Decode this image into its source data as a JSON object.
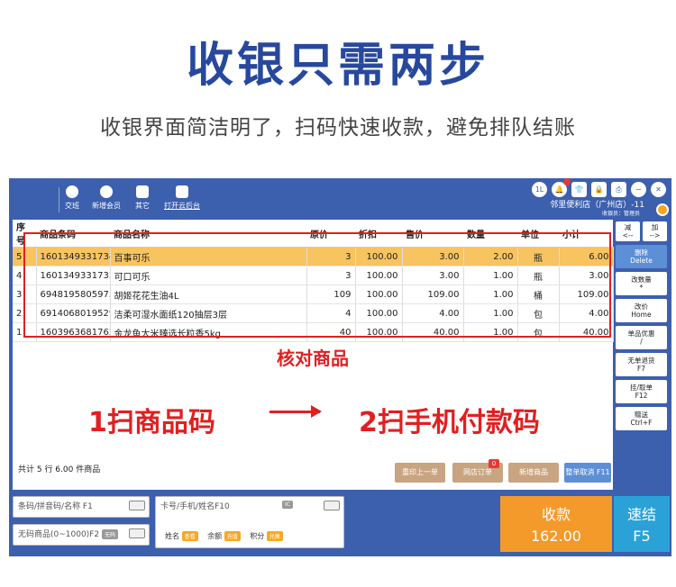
{
  "hero": {
    "title": "收银只需两步",
    "subtitle": "收银界面简洁明了，扫码快速收款，避免排队结账"
  },
  "toolbar": {
    "items": [
      "交班",
      "新增会员",
      "其它",
      "打开云后台"
    ]
  },
  "status": {
    "badge_1": "1L",
    "store": "邻里便利店（广州店）-11",
    "cashier": "收银员：管理员"
  },
  "table": {
    "headers": [
      "序号",
      "商品条码",
      "商品名称",
      "原价",
      "折扣",
      "售价",
      "数量",
      "单位",
      "小计"
    ],
    "rows": [
      [
        "5",
        "1601349331734",
        "百事可乐",
        "3",
        "100.00",
        "3.00",
        "2.00",
        "瓶",
        "6.00"
      ],
      [
        "4",
        "1601349331733",
        "可口可乐",
        "3",
        "100.00",
        "3.00",
        "1.00",
        "瓶",
        "3.00"
      ],
      [
        "3",
        "6948195805975",
        "胡姬花花生油4L",
        "109",
        "100.00",
        "109.00",
        "1.00",
        "桶",
        "109.00"
      ],
      [
        "2",
        "6914068019529",
        "洁柔可湿水面纸120抽层3层",
        "4",
        "100.00",
        "4.00",
        "1.00",
        "包",
        "4.00"
      ],
      [
        "1",
        "1603963681762",
        "金龙鱼大米臻选长粒香5kg",
        "40",
        "100.00",
        "40.00",
        "1.00",
        "包",
        "40.00"
      ]
    ]
  },
  "annotations": {
    "verify": "核对商品",
    "step1": "1扫商品码",
    "step2": "2扫手机付款码"
  },
  "summary": "共计 5 行 6.00 件商品",
  "actions": {
    "reprint": "重印上一单",
    "store_order": "网店订单",
    "store_order_badge": "0",
    "add_product": "新增商品",
    "cancel": "整单取消 F11"
  },
  "side": {
    "minus": "减\n<--",
    "plus": "加\n-->",
    "delete": "删除\nDelete",
    "change_qty": "改数量\n*",
    "change_price": "改价\nHome",
    "item_discount": "单品优惠\n/",
    "no_barcode": "无单退货\nF7",
    "hold": "挂/取单\nF12",
    "gift": "赠送\nCtrl+F"
  },
  "bottom": {
    "barcode_placeholder": "条码/拼音码/名称 F1",
    "no_code": "无码商品(0~1000)F2",
    "no_code_tag": "无码",
    "member_placeholder": "卡号/手机/姓名F10",
    "ic_tag": "IC",
    "name_label": "姓名",
    "name_tag": "查看",
    "balance_label": "余额",
    "balance_tag": "充值",
    "points_label": "积分",
    "points_tag": "兑换",
    "pay_title": "收款",
    "pay_amount": "162.00",
    "quick_title": "速结",
    "quick_key": "F5"
  }
}
